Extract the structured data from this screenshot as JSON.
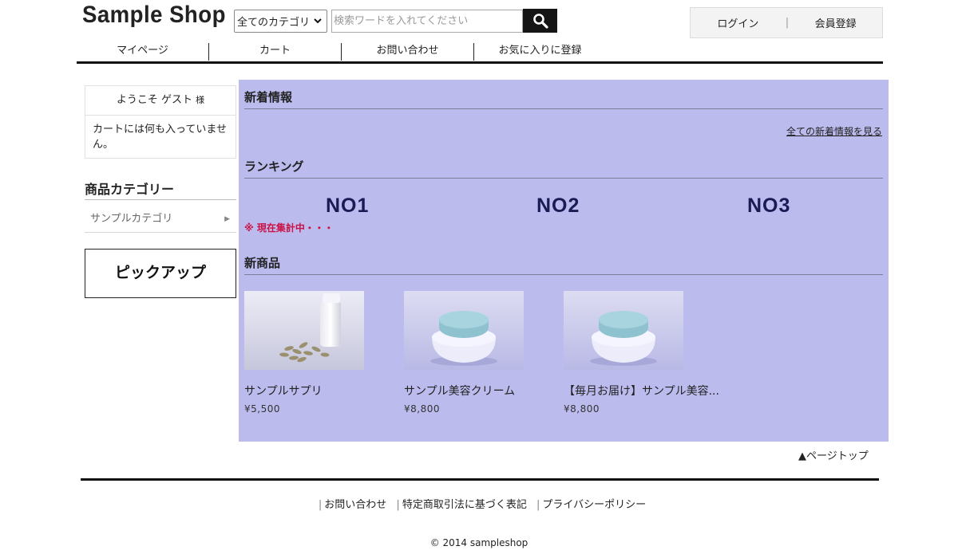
{
  "header": {
    "logo": "Sample Shop",
    "category_select": "全てのカテゴリ",
    "search_placeholder": "検索ワードを入れてください",
    "login": "ログイン",
    "register": "会員登録"
  },
  "nav": [
    "マイページ",
    "カート",
    "お問い合わせ",
    "お気に入りに登録"
  ],
  "sidebar": {
    "welcome": "ようこそ ゲスト",
    "welcome_suffix": "様",
    "cart_status": "カートには何も入っていません。",
    "category_title": "商品カテゴリー",
    "category_item": "サンプルカテゴリ",
    "pickup": "ピックアップ"
  },
  "main": {
    "news_title": "新着情報",
    "news_all_link": "全ての新着情報を見る",
    "ranking_title": "ランキング",
    "ranks": [
      "NO1",
      "NO2",
      "NO3"
    ],
    "ranking_note": "※ 現在集計中・・・",
    "new_title": "新商品",
    "products": [
      {
        "name": "サンプルサプリ",
        "price": "¥5,500"
      },
      {
        "name": "サンプル美容クリーム",
        "price": "¥8,800"
      },
      {
        "name": "【毎月お届け】サンプル美容...",
        "price": "¥8,800"
      }
    ]
  },
  "page_top": "▲ページトップ",
  "footer": {
    "links": [
      "お問い合わせ",
      "特定商取引法に基づく表記",
      "プライバシーポリシー"
    ],
    "copyright": "© 2014 sampleshop"
  },
  "colors": {
    "main_bg": "#bbbbee",
    "rank_text": "#1a1a55",
    "note_red": "#cc1144"
  }
}
